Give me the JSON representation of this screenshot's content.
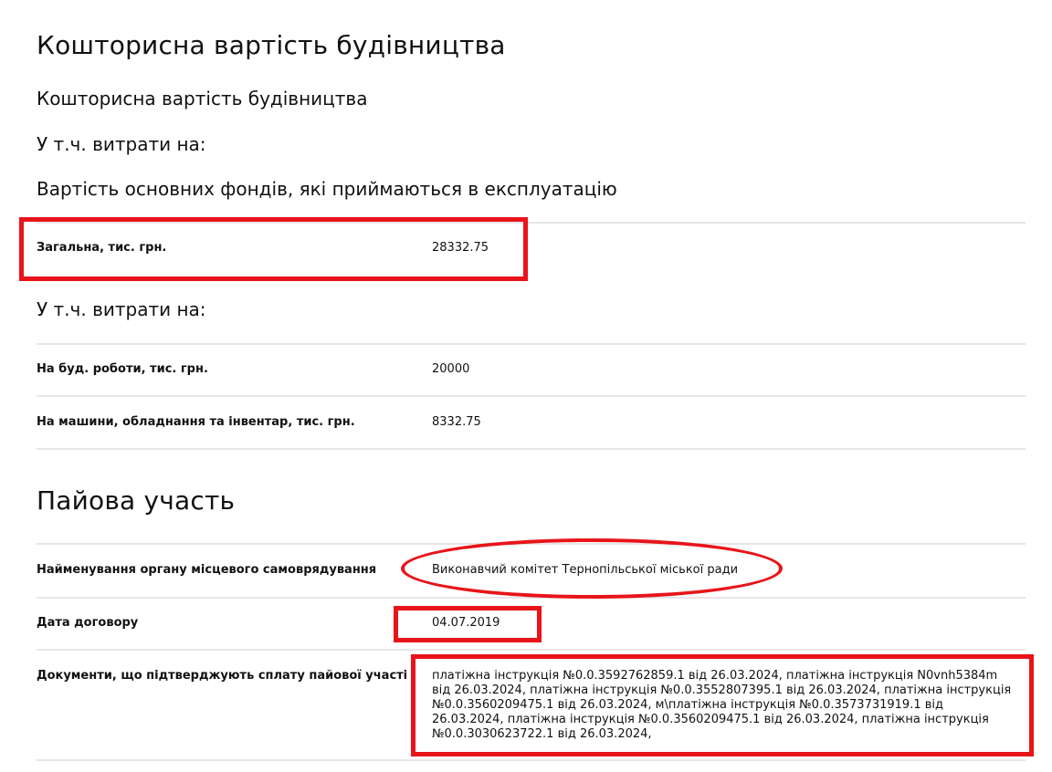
{
  "cost_section": {
    "title": "Кошторисна вартість будівництва",
    "subtitle": "Кошторисна вартість будівництва",
    "including_label_1": "У т.ч. витрати на:",
    "fixed_assets_title": "Вартість основних фондів, які приймаються в експлуатацію",
    "total": {
      "label": "Загальна, тис. грн.",
      "value": "28332.75"
    },
    "including_label_2": "У т.ч. витрати на:",
    "construction": {
      "label": "На буд. роботи, тис. грн.",
      "value": "20000"
    },
    "equipment": {
      "label": "На машини, обладнання та інвентар, тис. грн.",
      "value": "8332.75"
    }
  },
  "share_section": {
    "title": "Пайова участь",
    "authority": {
      "label": "Найменування органу місцевого самоврядування",
      "value": "Виконавчий комітет Тернопільської міської ради"
    },
    "contract_date": {
      "label": "Дата договору",
      "value": "04.07.2019"
    },
    "documents": {
      "label": "Документи, що підтверджують сплату пайової участі",
      "value": "платіжна інструкція №0.0.3592762859.1 від 26.03.2024, платіжна інструкція N0vnh5384m від 26.03.2024, платіжна інструкція №0.0.3552807395.1 від 26.03.2024, платіжна інструкція №0.0.3560209475.1 від 26.03.2024, м\\платіжна інструкція №0.0.3573731919.1 від 26.03.2024, платіжна інструкція №0.0.3560209475.1 від 26.03.2024, платіжна інструкція №0.0.3030623722.1 від 26.03.2024,"
    }
  },
  "annotation_color": "#e8141a"
}
